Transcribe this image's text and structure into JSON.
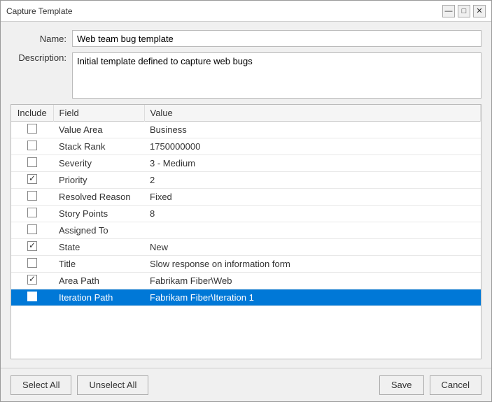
{
  "window": {
    "title": "Capture Template",
    "title_buttons": {
      "minimize": "—",
      "maximize": "□",
      "close": "✕"
    }
  },
  "form": {
    "name_label": "Name:",
    "name_value": "Web team bug template",
    "description_label": "Description:",
    "description_value": "Initial template defined to capture web bugs"
  },
  "table": {
    "headers": [
      "Include",
      "Field",
      "Value"
    ],
    "rows": [
      {
        "checked": false,
        "field": "Value Area",
        "value": "Business",
        "selected": false
      },
      {
        "checked": false,
        "field": "Stack Rank",
        "value": "1750000000",
        "selected": false
      },
      {
        "checked": false,
        "field": "Severity",
        "value": "3 - Medium",
        "selected": false
      },
      {
        "checked": true,
        "field": "Priority",
        "value": "2",
        "selected": false
      },
      {
        "checked": false,
        "field": "Resolved Reason",
        "value": "Fixed",
        "selected": false
      },
      {
        "checked": false,
        "field": "Story Points",
        "value": "8",
        "selected": false
      },
      {
        "checked": false,
        "field": "Assigned To",
        "value": "",
        "selected": false
      },
      {
        "checked": true,
        "field": "State",
        "value": "New",
        "selected": false
      },
      {
        "checked": false,
        "field": "Title",
        "value": "Slow response on information form",
        "selected": false
      },
      {
        "checked": true,
        "field": "Area Path",
        "value": "Fabrikam Fiber\\Web",
        "selected": false
      },
      {
        "checked": false,
        "field": "Iteration Path",
        "value": "Fabrikam Fiber\\Iteration 1",
        "selected": true
      }
    ]
  },
  "footer": {
    "select_all": "Select All",
    "unselect_all": "Unselect All",
    "save": "Save",
    "cancel": "Cancel"
  }
}
